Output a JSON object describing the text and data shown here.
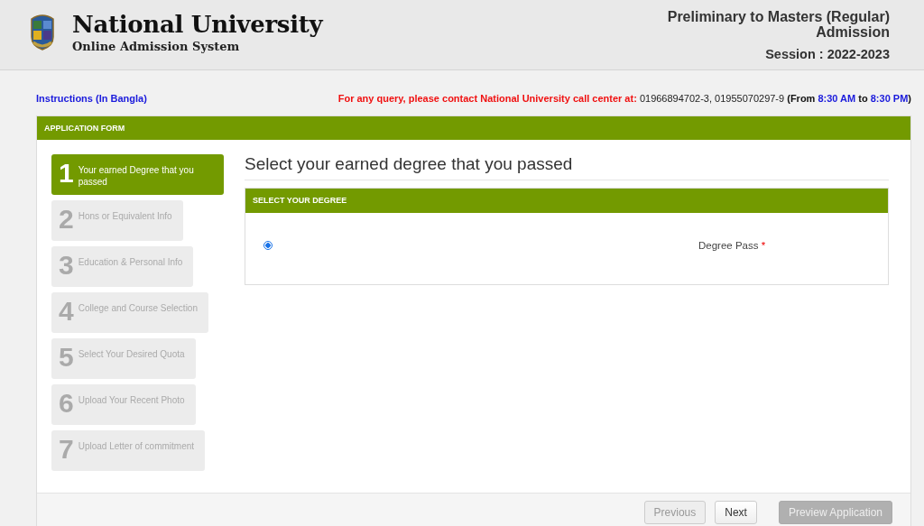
{
  "header": {
    "title": "National University",
    "subtitle": "Online Admission System",
    "program": "Preliminary to Masters (Regular) Admission",
    "session": "Session : 2022-2023"
  },
  "info": {
    "instructions_link": "Instructions (In Bangla)",
    "contact_notice": [
      {
        "text": "For any query, please contact National University call center at:",
        "kind": "alert"
      },
      {
        "text": "01966894702-3, 01955070297-9",
        "kind": "plain"
      },
      {
        "text": "(From",
        "kind": "bold"
      },
      {
        "text": "8:30 AM",
        "kind": "time"
      },
      {
        "text": "to",
        "kind": "bold"
      },
      {
        "text": "8:30 PM",
        "kind": "time"
      },
      {
        "text": ")",
        "kind": "bold_tight"
      }
    ]
  },
  "form": {
    "title": "APPLICATION FORM",
    "steps": [
      {
        "number": "1",
        "label": "Your earned Degree that you passed",
        "selected": true
      },
      {
        "number": "2",
        "label": "Hons or Equivalent Info",
        "selected": false
      },
      {
        "number": "3",
        "label": "Education & Personal Info",
        "selected": false
      },
      {
        "number": "4",
        "label": "College and Course Selection",
        "selected": false
      },
      {
        "number": "5",
        "label": "Select Your Desired Quota",
        "selected": false
      },
      {
        "number": "6",
        "label": "Upload Your Recent Photo",
        "selected": false
      },
      {
        "number": "7",
        "label": "Upload Letter of commitment",
        "selected": false
      }
    ],
    "heading": "Select your earned degree that you passed",
    "degree_panel": {
      "title": "SELECT YOUR DEGREE",
      "options": [
        {
          "label": "Degree Pass",
          "required_mark": "*",
          "selected": true
        }
      ]
    },
    "buttons": [
      {
        "label": "Previous",
        "kind": "default",
        "disabled": true
      },
      {
        "label": "Next",
        "kind": "default",
        "disabled": false
      },
      {
        "label": "Preview Application",
        "kind": "primary",
        "disabled": true
      }
    ]
  }
}
